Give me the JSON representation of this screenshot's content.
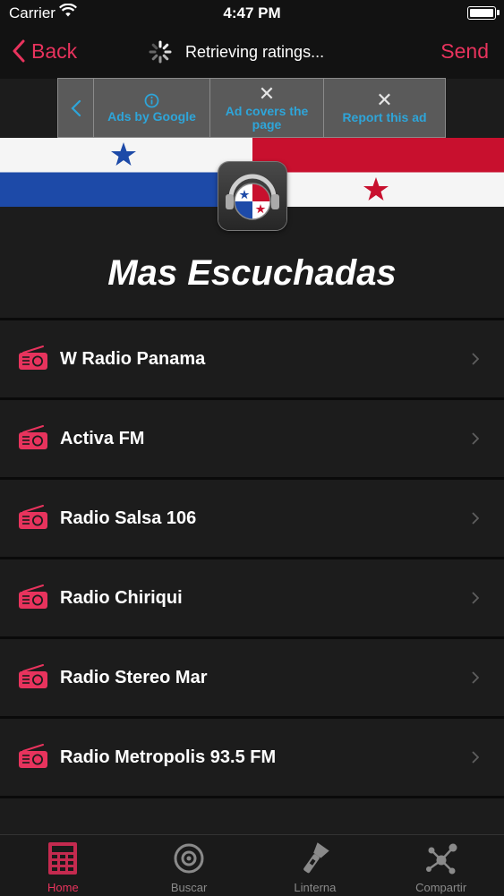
{
  "status_bar": {
    "carrier": "Carrier",
    "time": "4:47 PM"
  },
  "nav": {
    "back_label": "Back",
    "status_text": "Retrieving ratings...",
    "send_label": "Send"
  },
  "ad": {
    "ads_by_google": "Ads by Google",
    "ad_covers_page": "Ad covers the page",
    "report_ad": "Report this ad"
  },
  "page": {
    "title": "Mas Escuchadas"
  },
  "stations": [
    {
      "label": "W Radio Panama"
    },
    {
      "label": "Activa FM"
    },
    {
      "label": "Radio Salsa 106"
    },
    {
      "label": "Radio Chiriqui"
    },
    {
      "label": "Radio Stereo Mar"
    },
    {
      "label": "Radio Metropolis 93.5 FM"
    }
  ],
  "tabs": [
    {
      "label": "Home",
      "icon": "calculator-icon",
      "active": true
    },
    {
      "label": "Buscar",
      "icon": "target-icon",
      "active": false
    },
    {
      "label": "Linterna",
      "icon": "flashlight-icon",
      "active": false
    },
    {
      "label": "Compartir",
      "icon": "share-icon",
      "active": false
    }
  ],
  "colors": {
    "accent": "#e8335d",
    "ad_text": "#2ea5d9",
    "panama_blue": "#1d4aa8",
    "panama_red": "#c8102e"
  }
}
